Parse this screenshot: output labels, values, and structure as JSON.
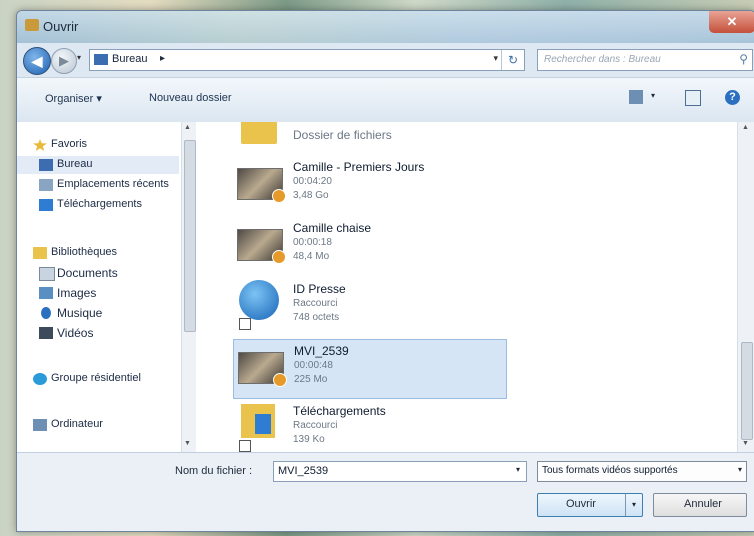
{
  "window": {
    "title": "Ouvrir",
    "close_label": "✕"
  },
  "nav": {
    "back_glyph": "◀",
    "forward_glyph": "▶",
    "breadcrumb": "Bureau",
    "crumb_arrow": "▸",
    "drop_glyph": "▾",
    "refresh_glyph": "↻",
    "search_placeholder": "Rechercher dans : Bureau",
    "search_glyph": "⚲"
  },
  "toolbar": {
    "organize": "Organiser ▾",
    "new_folder": "Nouveau dossier",
    "views_drop": "▾",
    "help": "?"
  },
  "sidebar": {
    "items": [
      {
        "label": "Favoris",
        "icon": "star-icon",
        "color": "#e9b93a"
      },
      {
        "label": "Bureau",
        "icon": "desktop-icon",
        "color": "#3b6db0"
      },
      {
        "label": "Emplacements récents",
        "icon": "recent-places-icon",
        "color": "#8aa5c2"
      },
      {
        "label": "Téléchargements",
        "icon": "downloads-icon",
        "color": "#2f7cd3"
      },
      {
        "label": "Bibliothèques",
        "icon": "library-icon",
        "color": "#e9c34b"
      },
      {
        "label": "Documents",
        "icon": "documents-icon",
        "color": "#c8d4e0"
      },
      {
        "label": "Images",
        "icon": "images-icon",
        "color": "#5a8fc2"
      },
      {
        "label": "Musique",
        "icon": "music-icon",
        "color": "#2a6fc0"
      },
      {
        "label": "Vidéos",
        "icon": "videos-icon",
        "color": "#3c4a5a"
      },
      {
        "label": "Groupe résidentiel",
        "icon": "homegroup-icon",
        "color": "#2a9bd8"
      },
      {
        "label": "Ordinateur",
        "icon": "computer-icon",
        "color": "#6d8fb3"
      }
    ]
  },
  "files": [
    {
      "name": "Dossier de fichiers",
      "meta1": "",
      "meta2": ""
    },
    {
      "name": "Camille - Premiers Jours",
      "meta1": "00:04:20",
      "meta2": "3,48 Go"
    },
    {
      "name": "Camille chaise",
      "meta1": "00:00:18",
      "meta2": "48,4 Mo"
    },
    {
      "name": "ID Presse",
      "meta1": "Raccourci",
      "meta2": "748 octets"
    },
    {
      "name": "MVI_2539",
      "meta1": "00:00:48",
      "meta2": "225 Mo"
    },
    {
      "name": "Téléchargements",
      "meta1": "Raccourci",
      "meta2": "139 Ko"
    }
  ],
  "bottom": {
    "filename_label": "Nom du fichier :",
    "filename_value": "MVI_2539",
    "filename_drop": "▾",
    "filter_value": "Tous formats vidéos supportés",
    "filter_drop": "▾",
    "open_label": "Ouvrir",
    "open_drop": "▾",
    "cancel_label": "Annuler"
  }
}
